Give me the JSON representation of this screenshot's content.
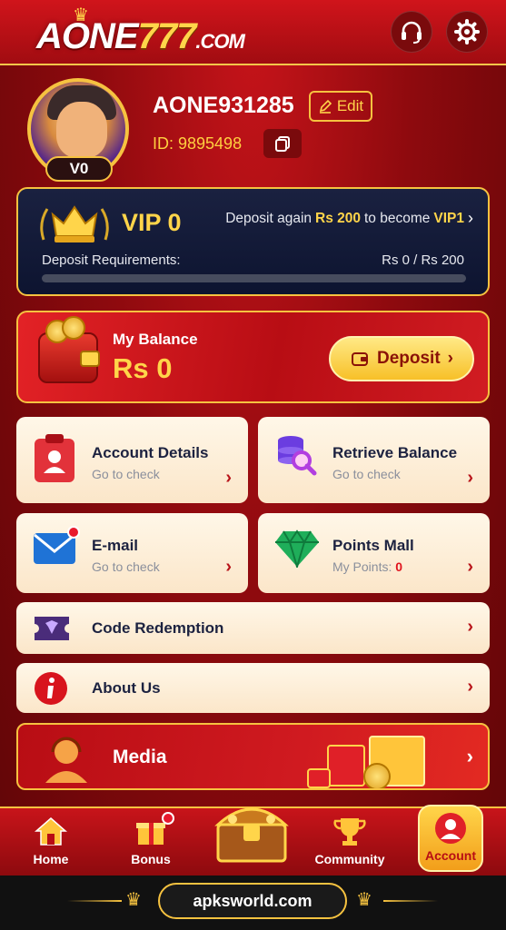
{
  "header": {
    "logo_main": "AONE",
    "logo_num": "777",
    "logo_suffix": ".COM",
    "icons": [
      "headset-icon",
      "gear-icon"
    ]
  },
  "profile": {
    "username": "AONE931285",
    "edit_label": "Edit",
    "id_text": "ID: 9895498",
    "vip_badge": "V0"
  },
  "vip": {
    "level_label": "VIP 0",
    "msg_prefix": "Deposit again",
    "msg_amount": "Rs 200",
    "msg_middle": "to become",
    "msg_target": "VIP1",
    "req_label": "Deposit Requirements:",
    "req_value": "Rs 0 / Rs 200",
    "progress_fraction": 0
  },
  "balance": {
    "label": "My Balance",
    "amount": "Rs 0",
    "deposit_label": "Deposit"
  },
  "menu": {
    "account_details": {
      "title": "Account Details",
      "sub": "Go to check"
    },
    "retrieve_balance": {
      "title": "Retrieve Balance",
      "sub": "Go to check"
    },
    "email": {
      "title": "E-mail",
      "sub": "Go to check"
    },
    "points_mall": {
      "title": "Points Mall",
      "sub_label": "My Points:",
      "points": "0"
    },
    "code_redemption": {
      "title": "Code Redemption"
    },
    "about_us": {
      "title": "About Us"
    },
    "media": {
      "title": "Media"
    }
  },
  "nav": {
    "home": "Home",
    "bonus": "Bonus",
    "community": "Community",
    "account": "Account"
  },
  "footer": {
    "site": "apksworld.com"
  },
  "colors": {
    "accent_gold": "#f6c240",
    "primary_red": "#b80d14",
    "text_dark": "#1c2240"
  }
}
